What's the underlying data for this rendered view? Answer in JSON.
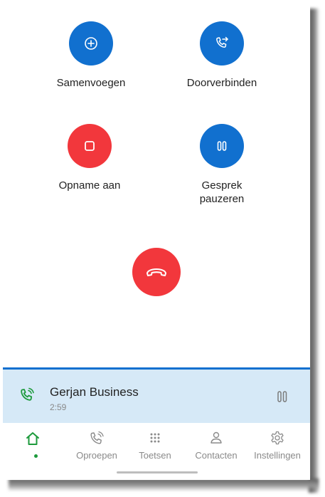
{
  "actions": [
    {
      "label": "Samenvoegen",
      "icon": "merge-icon",
      "color": "#1170cf"
    },
    {
      "label": "Doorverbinden",
      "icon": "transfer-icon",
      "color": "#1170cf"
    },
    {
      "label": "Opname aan",
      "icon": "record-icon",
      "color": "#f2373c"
    },
    {
      "label_line1": "Gesprek",
      "label_line2": "pauzeren",
      "icon": "pause-icon",
      "color": "#1170cf"
    }
  ],
  "end_call": {
    "icon": "hang-up-icon",
    "color": "#f2373c"
  },
  "active_call": {
    "name": "Gerjan Business",
    "duration": "2:59",
    "icon": "active-call-icon",
    "action_icon": "pause-icon"
  },
  "nav": {
    "items": [
      {
        "label": "",
        "icon": "home-icon",
        "active": true
      },
      {
        "label": "Oproepen",
        "icon": "calls-icon"
      },
      {
        "label": "Toetsen",
        "icon": "keypad-icon"
      },
      {
        "label": "Contacten",
        "icon": "contacts-icon"
      },
      {
        "label": "Instellingen",
        "icon": "settings-icon"
      }
    ]
  },
  "colors": {
    "accent_blue": "#1170cf",
    "danger_red": "#f2373c",
    "active_green": "#1d9a3c",
    "call_bar_bg": "#d6e9f7"
  }
}
